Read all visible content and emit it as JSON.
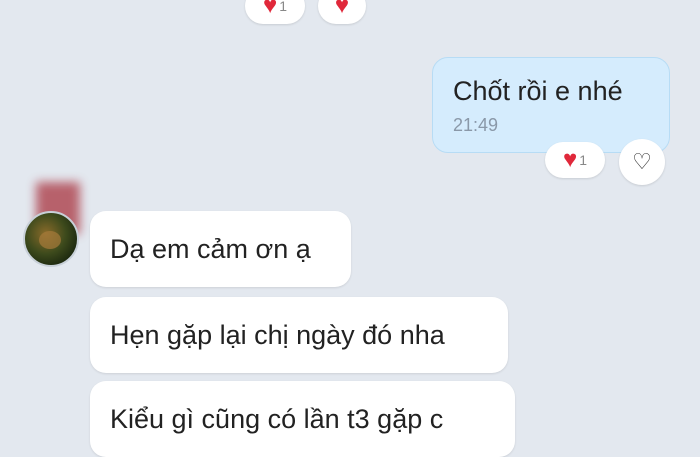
{
  "top_reactions": {
    "heart_count": "1"
  },
  "outgoing": {
    "message": "Chốt rồi e nhé",
    "time": "21:49",
    "reaction_count": "1"
  },
  "incoming": [
    {
      "text": "Dạ em cảm ơn ạ"
    },
    {
      "text": "Hẹn gặp lại chị ngày đó nha"
    },
    {
      "text": "Kiểu gì cũng có lần t3 gặp c"
    }
  ],
  "icons": {
    "heart": "♥",
    "heart_outline": "♡"
  },
  "colors": {
    "background": "#e3e8ef",
    "outgoing_bubble": "#d5ecfd",
    "heart": "#e0283a"
  }
}
